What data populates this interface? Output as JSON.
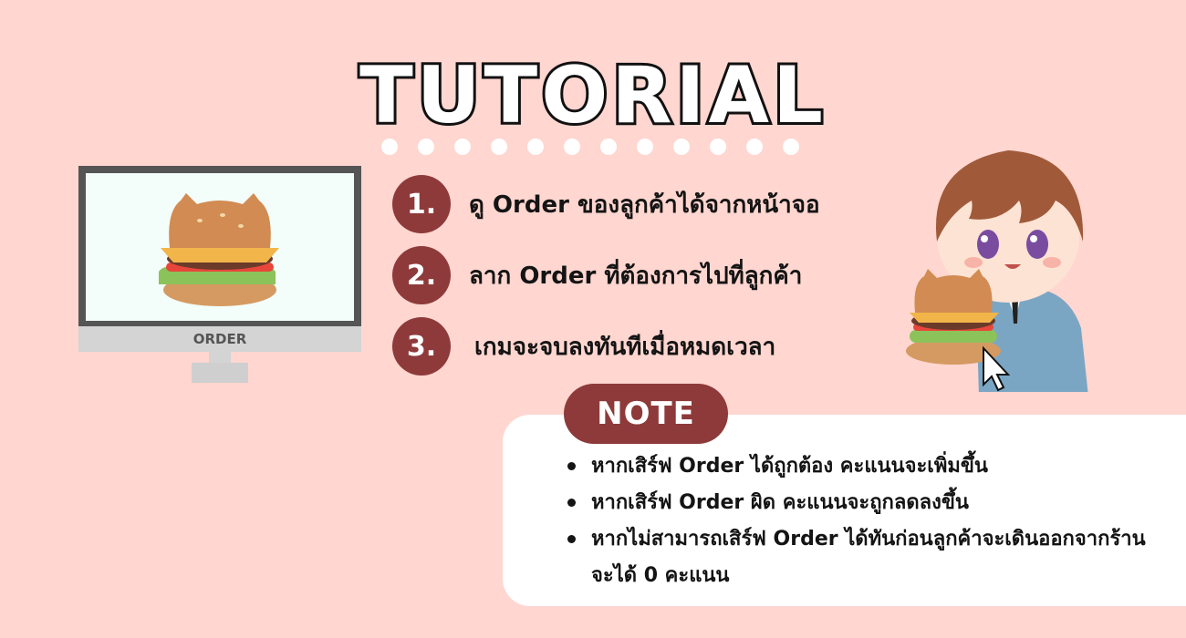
{
  "title": "TUTORIAL",
  "monitor": {
    "label": "ORDER"
  },
  "steps": [
    {
      "num": "1.",
      "text": "ดู Order ของลูกค้าได้จากหน้าจอ"
    },
    {
      "num": "2.",
      "text": "ลาก Order ที่ต้องการไปที่ลูกค้า"
    },
    {
      "num": "3.",
      "text": "เกมจะจบลงทันทีเมื่อหมดเวลา"
    }
  ],
  "note": {
    "label": "NOTE",
    "items": [
      "หากเสิร์ฟ Order ได้ถูกต้อง คะแนนจะเพิ่มขึ้น",
      "หากเสิร์ฟ Order ผิด คะแนนจะถูกลดลงขึ้น",
      "หากไม่สามารถเสิร์ฟ  Order  ได้ทันก่อนลูกค้าจะเดินออกจากร้าน จะได้ 0 คะแนน"
    ]
  },
  "colors": {
    "background": "#ffd6d0",
    "accent": "#8e3a3a",
    "card": "#ffffff"
  },
  "icons": [
    "burger-icon",
    "cursor-icon",
    "character-illustration"
  ]
}
